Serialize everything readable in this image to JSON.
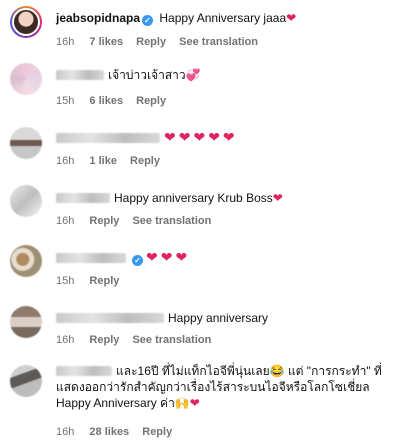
{
  "comments": [
    {
      "username": "jeabsopidnapa",
      "text": "Happy Anniversary jaaa",
      "emoji": "❤",
      "time": "16h",
      "likes": "7 likes",
      "reply": "Reply",
      "translate": "See translation"
    },
    {
      "text": "เจ้าบ่าวเจ้าสาว",
      "emoji": "💞",
      "time": "15h",
      "likes": "6 likes",
      "reply": "Reply"
    },
    {
      "text": "",
      "emoji": "❤❤❤❤❤",
      "time": "16h",
      "likes": "1 like",
      "reply": "Reply"
    },
    {
      "text": "Happy anniversary Krub Boss",
      "emoji": "❤",
      "time": "16h",
      "reply": "Reply",
      "translate": "See translation"
    },
    {
      "text": "",
      "emoji": "❤❤❤",
      "time": "15h",
      "reply": "Reply"
    },
    {
      "text": "Happy anniversary",
      "time": "16h",
      "reply": "Reply",
      "translate": "See translation"
    },
    {
      "text": "และ16ปี ที่ไม่แท็กไอจีพี่นุ่นเลย😂 แต่ \"การกระทำ\" ที่แสดงออกว่ารักสำคัญกว่าเรื่องไร้สาระบนไอจีหรือโลกโซเชี่ยล Happy Anniversary ค่า🙌",
      "emoji": "❤",
      "time": "16h",
      "likes": "28 likes",
      "reply": "Reply"
    }
  ],
  "colors": {
    "heart": "#e0245e",
    "verified": "#3897f0",
    "meta": "#737373"
  }
}
